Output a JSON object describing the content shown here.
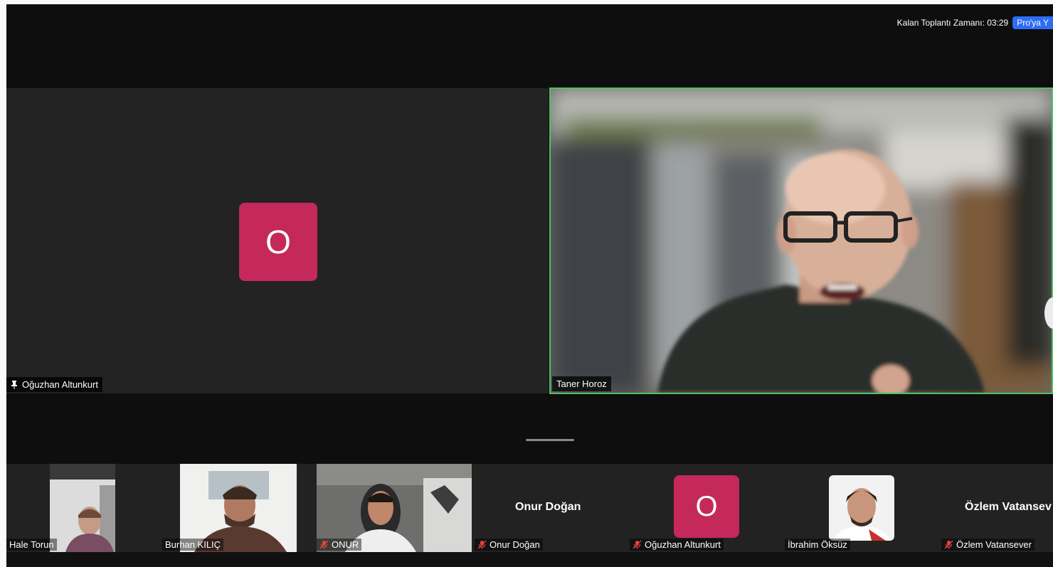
{
  "meeting": {
    "timer_text": "Kalan Toplantı Zamanı: 03:29",
    "pro_badge": "Pro'ya Y"
  },
  "main_tiles": [
    {
      "name": "Oğuzhan Altunkurt",
      "avatar_letter": "O",
      "pinned": true
    },
    {
      "name": "Taner Horoz",
      "active_speaker": true
    }
  ],
  "gallery": [
    {
      "name": "Hale Torun",
      "has_video": true,
      "muted": false
    },
    {
      "name": "Burhan KILIÇ",
      "has_video": true,
      "muted": false
    },
    {
      "name": "ONUR",
      "has_video": true,
      "muted": true
    },
    {
      "name": "Onur Doğan",
      "display_name": "Onur Doğan",
      "has_video": false,
      "muted": true
    },
    {
      "name": "Oğuzhan Altunkurt",
      "avatar_letter": "O",
      "has_video": false,
      "muted": true
    },
    {
      "name": "İbrahim Öksüz",
      "has_video": true,
      "muted": false
    },
    {
      "name": "Özlem Vatansever",
      "display_name": "Özlem Vatansev",
      "has_video": false,
      "muted": true
    }
  ],
  "colors": {
    "avatar_bg": "#c5285a",
    "active_speaker_border": "#4ec25f",
    "muted_icon": "#e8413b",
    "pro_badge_bg": "#2d6df6"
  }
}
